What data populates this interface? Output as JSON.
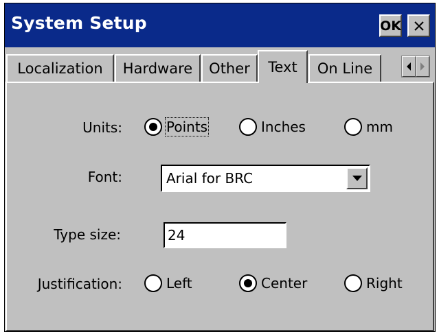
{
  "window": {
    "title": "System Setup",
    "ok_label": "OK"
  },
  "tabs": [
    {
      "label": "Localization",
      "active": false
    },
    {
      "label": "Hardware",
      "active": false
    },
    {
      "label": "Other",
      "active": false
    },
    {
      "label": "Text",
      "active": true
    },
    {
      "label": "On Line",
      "active": false
    }
  ],
  "units": {
    "label": "Units:",
    "options": [
      "Points",
      "Inches",
      "mm"
    ],
    "selected": "Points"
  },
  "font": {
    "label": "Font:",
    "value": "Arial for BRC"
  },
  "type_size": {
    "label": "Type size:",
    "value": "24"
  },
  "justification": {
    "label": "Justification:",
    "options": [
      "Left",
      "Center",
      "Right"
    ],
    "selected": "Center"
  },
  "colors": {
    "titlebar": "#0a2a8a",
    "face": "#c0c0c0"
  },
  "icons": [
    "close-icon",
    "tab-scroll-left-icon",
    "tab-scroll-right-icon",
    "dropdown-arrow-icon"
  ]
}
